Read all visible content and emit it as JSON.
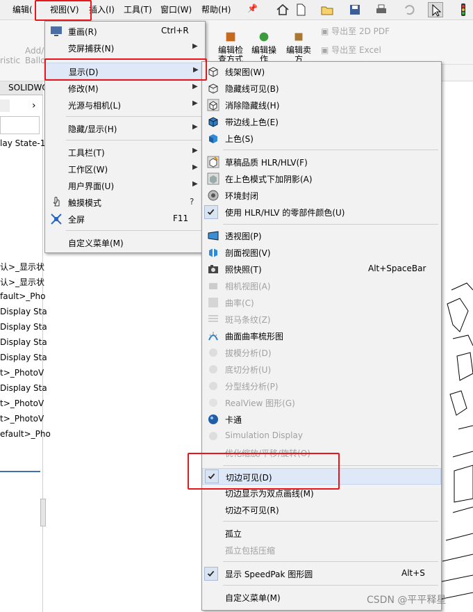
{
  "menubar": {
    "items": [
      "编辑(",
      "视图(V)",
      "插入(I)",
      "工具(T)",
      "窗口(W)",
      "帮助(H)"
    ]
  },
  "ribbon": {
    "left_labels": [
      "ristic",
      "Add/R",
      "Ballo"
    ],
    "edit_check": "编辑检查方式",
    "edit_op": "编辑操作",
    "edit_sell": "编辑卖方",
    "export_2d": "导出至 2D PDF",
    "export_excel": "导出至 Excel"
  },
  "left_panel": {
    "tab": "SOLIDWO",
    "tree": [
      "lay State-1",
      "认>_显示状",
      "认>_显示状",
      "fault>_Pho",
      "Display Sta",
      "Display Sta",
      "Display Sta",
      "Display Sta",
      "t>_PhotoV",
      "Display Sta",
      "t>_PhotoV",
      "t>_PhotoV",
      "efault>_Pho"
    ]
  },
  "view_menu": {
    "items": [
      {
        "label": "重画(R)",
        "accel": "Ctrl+R",
        "icon": "redraw-icon"
      },
      {
        "label": "荧屏捕获(N)",
        "submenu": true
      },
      {
        "label": "显示(D)",
        "submenu": true
      },
      {
        "label": "修改(M)",
        "submenu": true
      },
      {
        "label": "光源与相机(L)",
        "submenu": true
      },
      {
        "label": "隐藏/显示(H)",
        "submenu": true
      },
      {
        "label": "工具栏(T)",
        "submenu": true
      },
      {
        "label": "工作区(W)",
        "submenu": true
      },
      {
        "label": "用户界面(U)",
        "submenu": true
      },
      {
        "label": "触摸模式",
        "icon": "touch-icon"
      },
      {
        "label": "全屏",
        "accel": "F11",
        "icon": "fullscreen-icon"
      },
      {
        "label": "自定义菜单(M)"
      }
    ]
  },
  "display_menu": {
    "items": [
      {
        "label": "线架图(W)",
        "icon": "wireframe-icon"
      },
      {
        "label": "隐藏线可见(B)",
        "icon": "hidden-lines-visible-icon"
      },
      {
        "label": "消除隐藏线(H)",
        "icon": "hidden-lines-removed-icon"
      },
      {
        "label": "带边线上色(E)",
        "icon": "shaded-edges-icon"
      },
      {
        "label": "上色(S)",
        "icon": "shaded-icon"
      },
      {
        "label": "草稿品质 HLR/HLV(F)",
        "icon": "draft-quality-icon"
      },
      {
        "label": "在上色模式下加阴影(A)",
        "icon": "shadows-icon"
      },
      {
        "label": "环境封闭",
        "icon": "ambient-occlusion-icon"
      },
      {
        "label": "使用 HLR/HLV 的零部件颜色(U)",
        "checked": true
      },
      {
        "label": "透视图(P)",
        "icon": "perspective-icon"
      },
      {
        "label": "剖面视图(V)",
        "icon": "section-view-icon"
      },
      {
        "label": "照快照(T)",
        "accel": "Alt+SpaceBar",
        "icon": "camera-icon"
      },
      {
        "label": "相机视图(A)",
        "disabled": true,
        "icon": "camera-view-icon"
      },
      {
        "label": "曲率(C)",
        "disabled": true,
        "icon": "curvature-icon"
      },
      {
        "label": "斑马条纹(Z)",
        "disabled": true,
        "icon": "zebra-icon"
      },
      {
        "label": "曲面曲率梳形图",
        "icon": "curvature-comb-icon"
      },
      {
        "label": "拔模分析(D)",
        "disabled": true,
        "icon": "draft-analysis-icon"
      },
      {
        "label": "底切分析(U)",
        "disabled": true,
        "icon": "undercut-icon"
      },
      {
        "label": "分型线分析(P)",
        "disabled": true,
        "icon": "parting-line-icon"
      },
      {
        "label": "RealView 图形(G)",
        "disabled": true,
        "icon": "realview-icon"
      },
      {
        "label": "卡通",
        "icon": "cartoon-icon"
      },
      {
        "label": "Simulation Display",
        "disabled": true,
        "icon": "simulation-icon"
      },
      {
        "label": "优化缩放/平移/旋转(O)",
        "disabled": true
      },
      {
        "label": "切边可见(D)",
        "checked": true
      },
      {
        "label": "切边显示为双点画线(M)"
      },
      {
        "label": "切边不可见(R)"
      },
      {
        "label": "孤立"
      },
      {
        "label": "孤立包括压缩",
        "disabled": true
      },
      {
        "label": "显示 SpeedPak 图形圆",
        "accel": "Alt+S",
        "checked": true
      },
      {
        "label": "自定义菜单(M)"
      }
    ]
  },
  "watermark": "CSDN @平平释星",
  "colors": {
    "highlight_box": "#e8161b",
    "menu_bg": "#f2f2f2"
  }
}
